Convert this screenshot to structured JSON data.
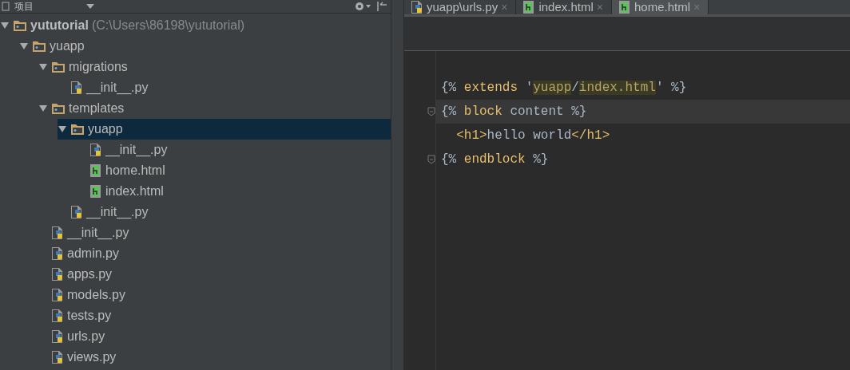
{
  "project_panel": {
    "title": "项目",
    "tree": [
      {
        "kind": "folder",
        "name": "yututorial",
        "path": "(C:\\Users\\86198\\yututorial)",
        "expanded": true,
        "selected": false,
        "children": [
          {
            "kind": "folder",
            "name": "yuapp",
            "expanded": true,
            "selected": false,
            "children": [
              {
                "kind": "folder",
                "name": "migrations",
                "expanded": true,
                "selected": false,
                "children": [
                  {
                    "kind": "py",
                    "name": "__init__.py",
                    "selected": false
                  }
                ]
              },
              {
                "kind": "folder",
                "name": "templates",
                "expanded": true,
                "selected": false,
                "children": [
                  {
                    "kind": "folder",
                    "name": "yuapp",
                    "expanded": true,
                    "selected": true,
                    "children": [
                      {
                        "kind": "py",
                        "name": "__init__.py",
                        "selected": false
                      },
                      {
                        "kind": "html",
                        "name": "home.html",
                        "selected": false
                      },
                      {
                        "kind": "html",
                        "name": "index.html",
                        "selected": false
                      }
                    ]
                  },
                  {
                    "kind": "py",
                    "name": "__init__.py",
                    "selected": false
                  }
                ]
              },
              {
                "kind": "py",
                "name": "__init__.py",
                "selected": false
              },
              {
                "kind": "py",
                "name": "admin.py",
                "selected": false
              },
              {
                "kind": "py",
                "name": "apps.py",
                "selected": false
              },
              {
                "kind": "py",
                "name": "models.py",
                "selected": false
              },
              {
                "kind": "py",
                "name": "tests.py",
                "selected": false
              },
              {
                "kind": "py",
                "name": "urls.py",
                "selected": false
              },
              {
                "kind": "py",
                "name": "views.py",
                "selected": false
              }
            ]
          }
        ]
      }
    ]
  },
  "tabs": [
    {
      "kind": "py",
      "label": "yuapp\\urls.py",
      "close": "×",
      "selected": false
    },
    {
      "kind": "html",
      "label": "index.html",
      "close": "×",
      "selected": false
    },
    {
      "kind": "html",
      "label": "home.html",
      "close": "×",
      "selected": true
    }
  ],
  "editor": {
    "lines": [
      {
        "fold": false,
        "current": false,
        "tokens": [
          {
            "kind": "tag",
            "text": "{%"
          },
          {
            "kind": "keyword",
            "text": " extends "
          },
          {
            "kind": "string",
            "text": "'"
          },
          {
            "kind": "match",
            "text": "yuapp"
          },
          {
            "kind": "string",
            "text": "/"
          },
          {
            "kind": "match",
            "text": "index.html"
          },
          {
            "kind": "string",
            "text": "'"
          },
          {
            "kind": "tag",
            "text": " %}"
          }
        ]
      },
      {
        "fold": true,
        "current": true,
        "tokens": [
          {
            "kind": "tag",
            "text": "{%"
          },
          {
            "kind": "keyword",
            "text": " block"
          },
          {
            "kind": "plain",
            "text": " content "
          },
          {
            "kind": "tag",
            "text": "%}"
          }
        ]
      },
      {
        "fold": false,
        "current": false,
        "tokens": [
          {
            "kind": "keyword",
            "text": "  <h1>"
          },
          {
            "kind": "plain",
            "text": "hello world"
          },
          {
            "kind": "keyword",
            "text": "</h1>"
          }
        ]
      },
      {
        "fold": true,
        "current": false,
        "tokens": [
          {
            "kind": "tag",
            "text": "{%"
          },
          {
            "kind": "keyword",
            "text": " endblock "
          },
          {
            "kind": "tag",
            "text": "%}"
          }
        ]
      }
    ]
  }
}
